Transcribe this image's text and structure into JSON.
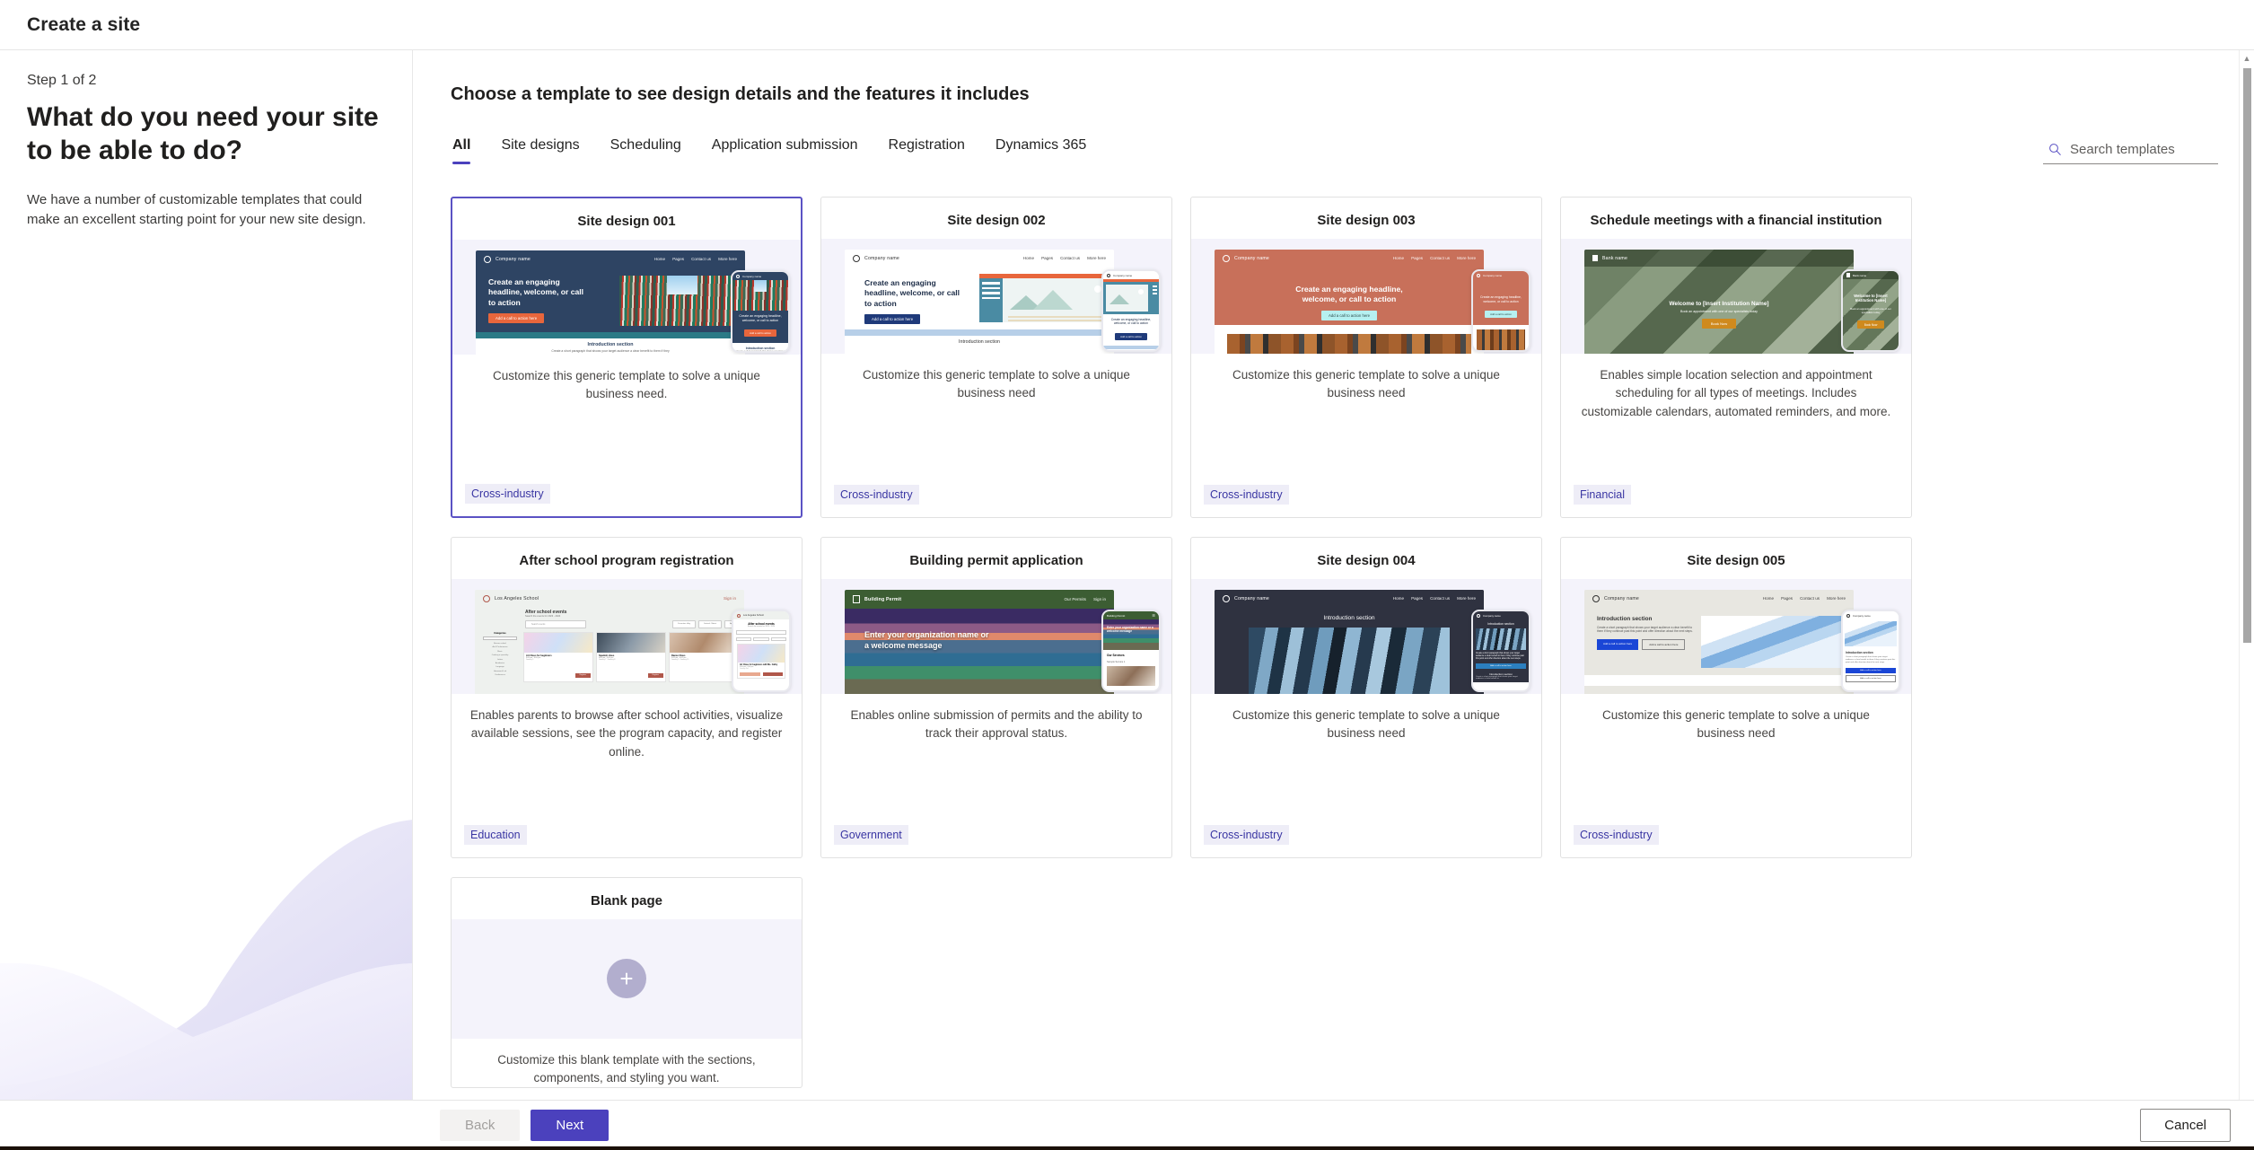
{
  "window": {
    "title": "Create a site"
  },
  "left": {
    "step": "Step 1 of 2",
    "heading": "What do you need your site to be able to do?",
    "subtext": "We have a number of customizable templates that could make an excellent starting point for your new site design."
  },
  "main": {
    "page_heading": "Choose a template to see design details and the features it includes",
    "tabs": [
      {
        "label": "All",
        "active": true
      },
      {
        "label": "Site designs",
        "active": false
      },
      {
        "label": "Scheduling",
        "active": false
      },
      {
        "label": "Application submission",
        "active": false
      },
      {
        "label": "Registration",
        "active": false
      },
      {
        "label": "Dynamics 365",
        "active": false
      }
    ],
    "search": {
      "placeholder": "Search templates",
      "value": "",
      "icon": "search-icon"
    }
  },
  "cards": [
    {
      "title": "Site design 001",
      "description": "Customize this generic template to solve a unique business need.",
      "tag": "Cross-industry",
      "selected": true,
      "preview": {
        "nav_brand": "Company name",
        "nav_links": [
          "Home",
          "Pages",
          "Contact us",
          "More here"
        ],
        "hero_title": "Create an engaging headline, welcome, or call to action",
        "cta": "Add a call to action here",
        "section_title": "Introduction section",
        "section_body": "Create a short paragraph that shows your target audience a clear benefit to them if they"
      }
    },
    {
      "title": "Site design 002",
      "description": "Customize this generic template to solve a unique business need",
      "tag": "Cross-industry",
      "selected": false,
      "preview": {
        "nav_brand": "Company name",
        "nav_links": [
          "Home",
          "Pages",
          "Contact us",
          "More here"
        ],
        "hero_title": "Create an engaging headline, welcome, or call to action",
        "cta": "Add a call to action here",
        "section_title": "Introduction section"
      }
    },
    {
      "title": "Site design 003",
      "description": "Customize this generic template to solve a unique business need",
      "tag": "Cross-industry",
      "selected": false,
      "preview": {
        "nav_brand": "Company name",
        "nav_links": [
          "Home",
          "Pages",
          "Contact us",
          "More here"
        ],
        "hero_title": "Create an engaging headline, welcome, or call to action",
        "cta": "Add a call to action here"
      }
    },
    {
      "title": "Schedule meetings with a financial institution",
      "description": "Enables simple location selection and appointment scheduling for all types of meetings. Includes customizable calendars, automated reminders, and more.",
      "tag": "Financial",
      "selected": false,
      "preview": {
        "nav_brand": "Bank name",
        "hero_title": "Welcome to [Insert Institution Name]",
        "hero_sub": "Book an appointment with one of our specialists today",
        "cta": "Book Now"
      }
    },
    {
      "title": "After school program registration",
      "description": "Enables parents to browse after school activities, visualize available sessions, see the program capacity, and register online.",
      "tag": "Education",
      "selected": false,
      "preview": {
        "nav_brand": "Los Angeles School",
        "sign_in": "Sign in",
        "hero_title": "After school events",
        "hero_sub": "Search the events for 2023 - 2024",
        "search_placeholder": "Search events",
        "filters": [
          "Favorites: Any",
          "Sorted: Oldest",
          "Age"
        ],
        "sidebar_title": "Categories",
        "cards": [
          {
            "name": "Art Class for beginners",
            "time": "3:00 pm - 4:00 pm",
            "date": "January 5",
            "cta": "Register"
          },
          {
            "name": "Spanish class",
            "time": "4:00 pm - 5:00 pm",
            "date": "January 7 - January 8",
            "cta": "Register"
          },
          {
            "name": "Dance Class",
            "time": "3:00 pm - 4:00 pm",
            "date": "January 5 - January 15",
            "cta": "Register"
          }
        ]
      }
    },
    {
      "title": "Building permit application",
      "description": "Enables online submission of permits and the ability to track their approval status.",
      "tag": "Government",
      "selected": false,
      "preview": {
        "nav_brand": "Building Permit",
        "nav_links": [
          "Our Permits",
          "Sign in"
        ],
        "hero_title": "Enter your organization name or a welcome message",
        "section_title": "Our Services",
        "section_item": "Sample Service 1"
      }
    },
    {
      "title": "Site design 004",
      "description": "Customize this generic template to solve a unique business need",
      "tag": "Cross-industry",
      "selected": false,
      "preview": {
        "nav_brand": "Company name",
        "nav_links": [
          "Home",
          "Pages",
          "Contact us",
          "More here"
        ],
        "section_title": "Introduction section",
        "cta": "Add a call to action here"
      }
    },
    {
      "title": "Site design 005",
      "description": "Customize this generic template to solve a unique business need",
      "tag": "Cross-industry",
      "selected": false,
      "preview": {
        "nav_brand": "Company name",
        "nav_links": [
          "Home",
          "Pages",
          "Contact us",
          "More here"
        ],
        "section_title": "Introduction section",
        "section_body": "Create a short paragraph that shows your target audience a clear benefit to them if they continue past this point and offer direction about the next steps.",
        "cta": "Add a call to action here",
        "cta2": "Add a call to action here"
      }
    },
    {
      "title": "Blank page",
      "description": "Customize this blank template with the sections, components, and styling you want.",
      "tag": "",
      "selected": false,
      "preview": {
        "icon": "plus-icon"
      }
    }
  ],
  "footer": {
    "back_label": "Back",
    "next_label": "Next",
    "cancel_label": "Cancel"
  },
  "colors": {
    "accent": "#4b41bd",
    "selected_border": "#5b52c4",
    "tag_bg": "#eeedf7",
    "tag_text": "#3a36a3"
  }
}
